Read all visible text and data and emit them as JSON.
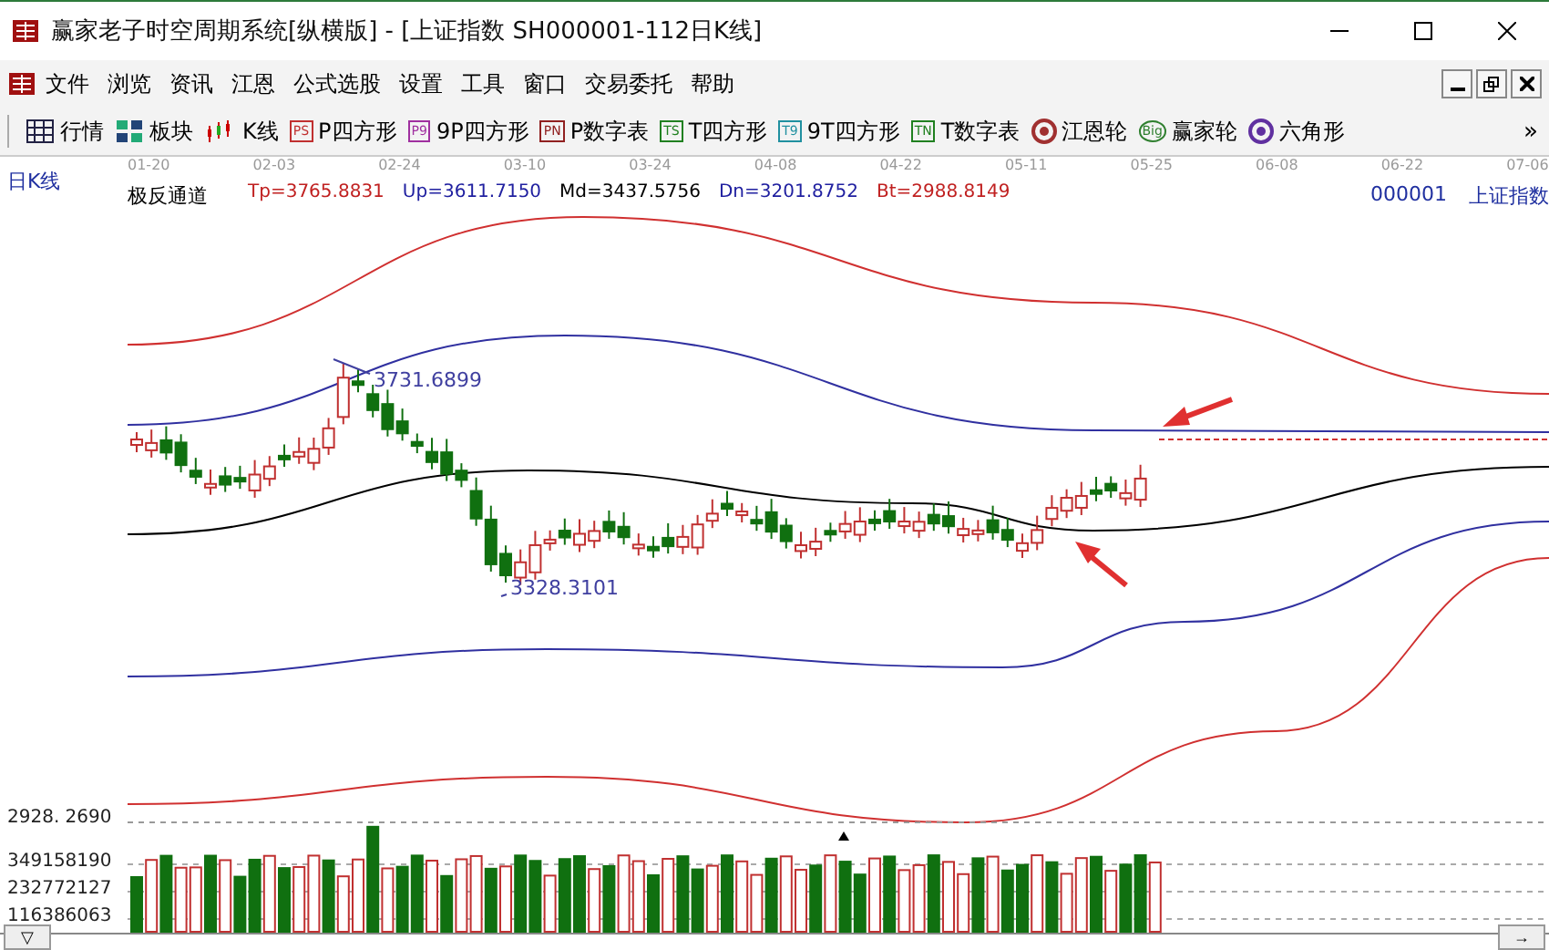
{
  "window": {
    "title": "赢家老子时空周期系统[纵横版] - [上证指数  SH000001-112日K线]"
  },
  "menu": [
    "文件",
    "浏览",
    "资讯",
    "江恩",
    "公式选股",
    "设置",
    "工具",
    "窗口",
    "交易委托",
    "帮助"
  ],
  "toolbar": [
    {
      "label": "行情",
      "kind": "grid"
    },
    {
      "label": "板块",
      "kind": "blocks"
    },
    {
      "label": "K线",
      "kind": "candle"
    },
    {
      "label": "P四方形",
      "kind": "box",
      "badge": "PS",
      "color": "#c03030"
    },
    {
      "label": "9P四方形",
      "kind": "box",
      "badge": "P9",
      "color": "#a030a0"
    },
    {
      "label": "P数字表",
      "kind": "box",
      "badge": "PN",
      "color": "#902020"
    },
    {
      "label": "T四方形",
      "kind": "box",
      "badge": "TS",
      "color": "#208020"
    },
    {
      "label": "9T四方形",
      "kind": "box",
      "badge": "T9",
      "color": "#2090a0"
    },
    {
      "label": "T数字表",
      "kind": "box",
      "badge": "TN",
      "color": "#208020"
    },
    {
      "label": "江恩轮",
      "kind": "wheel",
      "color": "#a03030"
    },
    {
      "label": "赢家轮",
      "kind": "wheel",
      "badge": "Big",
      "color": "#308030"
    },
    {
      "label": "六角形",
      "kind": "wheel",
      "color": "#6030a0"
    }
  ],
  "toolbar_more": "»",
  "period": "日K线",
  "dates": [
    "01-20",
    "02-03",
    "02-24",
    "03-10",
    "03-24",
    "04-08",
    "04-22",
    "05-11",
    "05-25",
    "06-08",
    "06-22",
    "07-06"
  ],
  "indicator": {
    "name": "极反通道",
    "values": [
      {
        "text": "Tp=3765.8831",
        "color": "#c02020"
      },
      {
        "text": "Up=3611.7150",
        "color": "#2020a0"
      },
      {
        "text": "Md=3437.5756",
        "color": "#000000"
      },
      {
        "text": "Dn=3201.8752",
        "color": "#2020a0"
      },
      {
        "text": "Bt=2988.8149",
        "color": "#c02020"
      }
    ]
  },
  "symbol": {
    "code": "000001",
    "name": "上证指数"
  },
  "annotations": [
    "3731.6899",
    "3328.3101"
  ],
  "price_level": "2928. 2690",
  "volume_ticks": [
    "349158190",
    "232772127",
    "116386063"
  ],
  "scroll_left": "▽",
  "scroll_right": "→"
}
